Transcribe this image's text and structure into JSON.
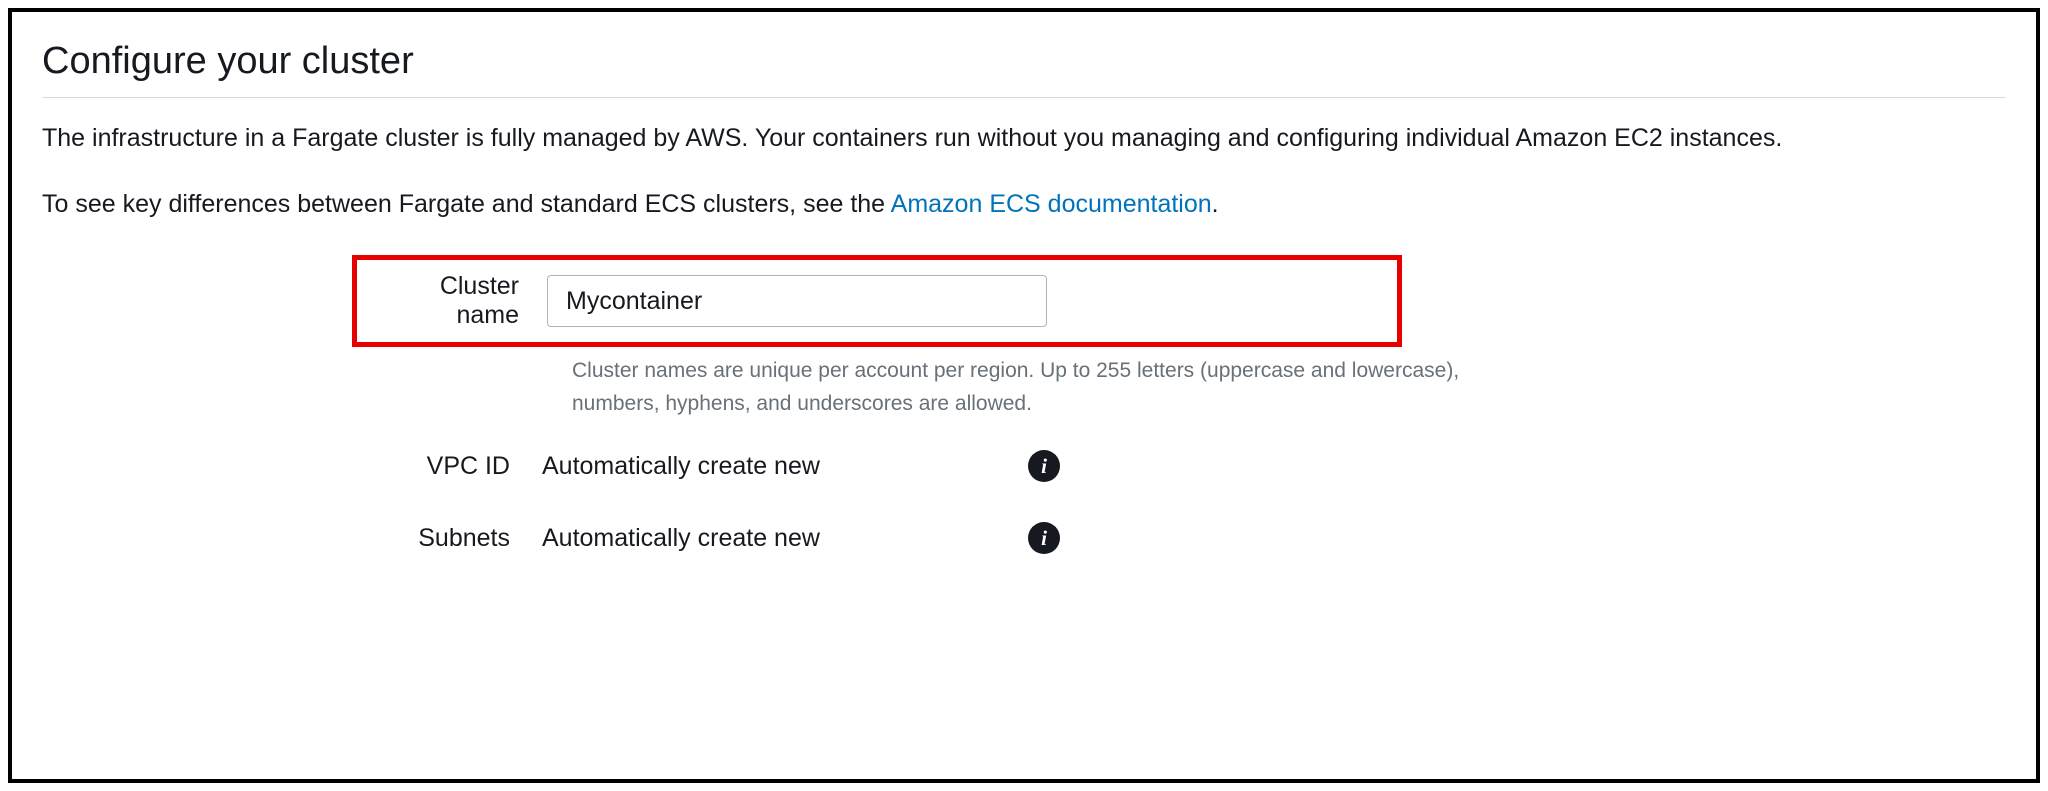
{
  "header": {
    "title": "Configure your cluster"
  },
  "description": {
    "paragraph1": "The infrastructure in a Fargate cluster is fully managed by AWS. Your containers run without you managing and configuring individual Amazon EC2 instances.",
    "paragraph2_prefix": "To see key differences between Fargate and standard ECS clusters, see the ",
    "paragraph2_link": "Amazon ECS documentation",
    "paragraph2_suffix": "."
  },
  "form": {
    "cluster_name": {
      "label": "Cluster name",
      "value": "Mycontainer",
      "helper": "Cluster names are unique per account per region. Up to 255 letters (uppercase and lowercase), numbers, hyphens, and underscores are allowed."
    },
    "vpc_id": {
      "label": "VPC ID",
      "value": "Automatically create new"
    },
    "subnets": {
      "label": "Subnets",
      "value": "Automatically create new"
    }
  },
  "icons": {
    "info": "i"
  }
}
